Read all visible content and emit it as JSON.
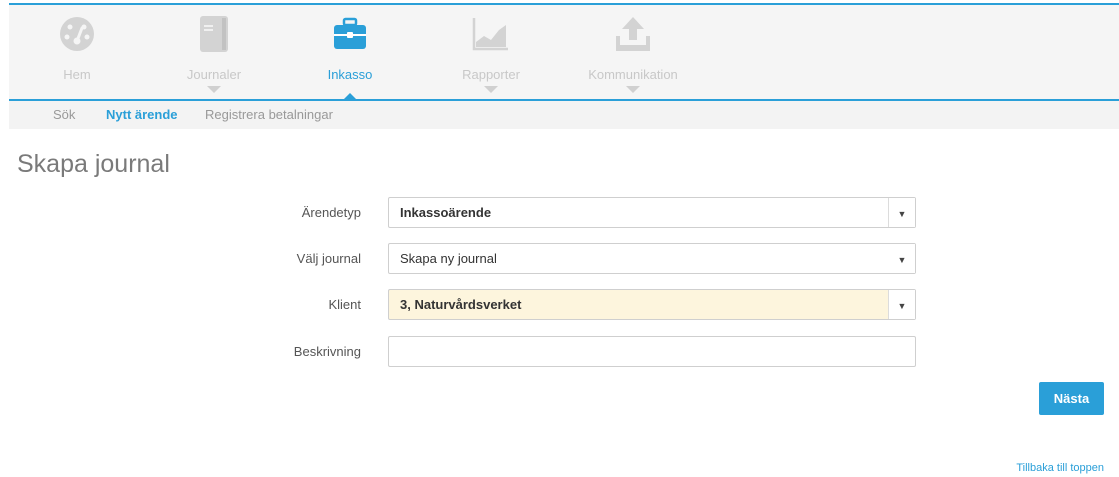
{
  "topnav": {
    "items": [
      {
        "label": "Hem",
        "icon": "dashboard-icon"
      },
      {
        "label": "Journaler",
        "icon": "book-icon"
      },
      {
        "label": "Inkasso",
        "icon": "briefcase-icon"
      },
      {
        "label": "Rapporter",
        "icon": "chart-icon"
      },
      {
        "label": "Kommunikation",
        "icon": "upload-icon"
      }
    ],
    "active": "Inkasso"
  },
  "subnav": {
    "items": [
      {
        "label": "Sök"
      },
      {
        "label": "Nytt ärende"
      },
      {
        "label": "Registrera betalningar"
      }
    ],
    "active": "Nytt ärende"
  },
  "page": {
    "title": "Skapa journal"
  },
  "form": {
    "arendetyp": {
      "label": "Ärendetyp",
      "value": "Inkassoärende"
    },
    "valj_journal": {
      "label": "Välj journal",
      "value": "Skapa ny journal"
    },
    "klient": {
      "label": "Klient",
      "value": "3, Naturvårdsverket"
    },
    "beskrivning": {
      "label": "Beskrivning",
      "value": ""
    }
  },
  "actions": {
    "next_label": "Nästa"
  },
  "footer": {
    "back_to_top": "Tillbaka till toppen"
  },
  "colors": {
    "accent": "#2a9fd8",
    "highlight": "#fdf5dd",
    "inactive": "#c8c8c8"
  }
}
